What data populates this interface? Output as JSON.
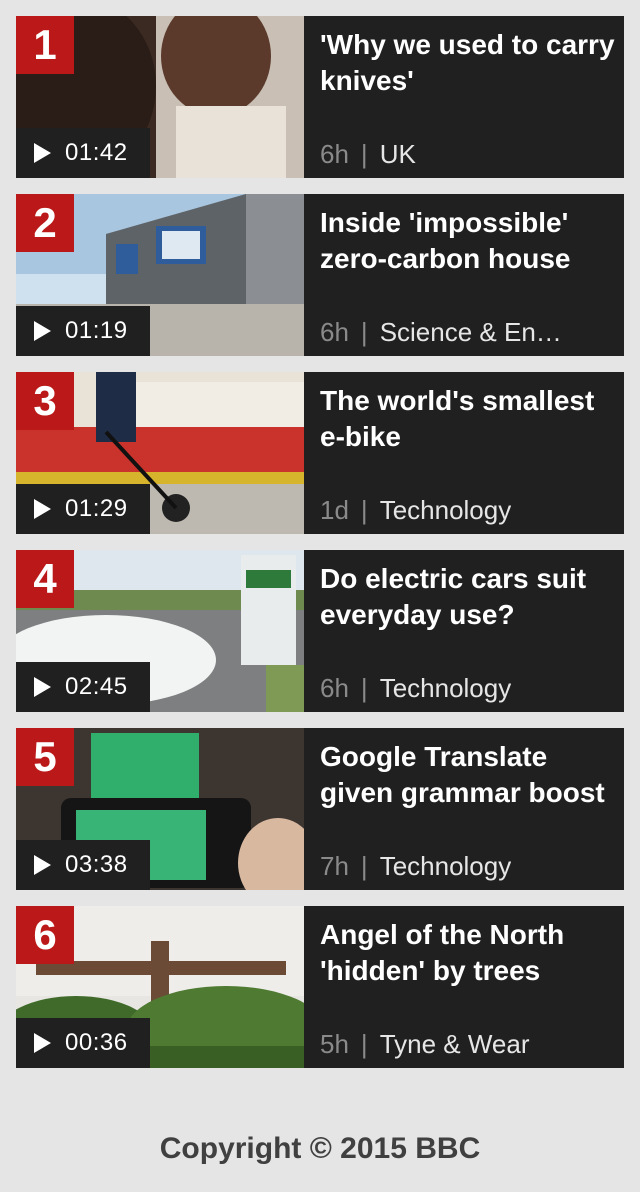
{
  "items": [
    {
      "rank": "1",
      "duration": "01:42",
      "title": "'Why we used to carry knives'",
      "age": "6h",
      "section": "UK"
    },
    {
      "rank": "2",
      "duration": "01:19",
      "title": "Inside 'impossible' zero-carbon house",
      "age": "6h",
      "section": "Science & En…"
    },
    {
      "rank": "3",
      "duration": "01:29",
      "title": "The world's smallest e-bike",
      "age": "1d",
      "section": "Technology"
    },
    {
      "rank": "4",
      "duration": "02:45",
      "title": "Do electric cars suit everyday use?",
      "age": "6h",
      "section": "Technology"
    },
    {
      "rank": "5",
      "duration": "03:38",
      "title": "Google Translate given grammar boost",
      "age": "7h",
      "section": "Technology"
    },
    {
      "rank": "6",
      "duration": "00:36",
      "title": "Angel of the North 'hidden' by trees",
      "age": "5h",
      "section": "Tyne & Wear"
    }
  ],
  "separator": "|",
  "footer": {
    "copyright": "Copyright © 2015 BBC"
  },
  "colors": {
    "rank_badge": "#bb1919",
    "card_bg": "#202020",
    "page_bg": "#e5e5e5"
  }
}
